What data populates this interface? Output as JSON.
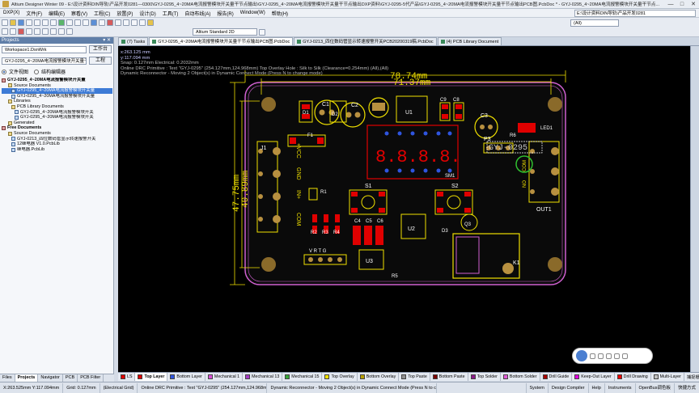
{
  "window": {
    "title": "Altium Designer Winter 09 - E:\\设计资料DIN导轨\\产品开发0281—0300\\GYJ-0295_4~20MA电流报警模块开关量干节点输出\\GYJ-0295_4~20MA电流报警模块开关量干节点输出DXP资料\\GYJ-0295-5代产品\\GYJ-0295_4~20MA电流报警模块开关量干节点输出PCB图.PcbDoc * - GYJ-0295_4~20MA电流报警模块开关量干节点...",
    "min": "—",
    "max": "□",
    "close": "✕"
  },
  "menu": {
    "items": [
      "DXP(X)",
      "文件(F)",
      "编辑(E)",
      "察看(V)",
      "工程(C)",
      "放置(P)",
      "设计(D)",
      "工具(T)",
      "自动布线(A)",
      "报告(R)",
      "Window(W)",
      "帮助(H)"
    ],
    "path": "E:\\设计资料DIN导轨\\产品开发0281"
  },
  "toolbar": {
    "combo_standard": "Altium Standard 2D",
    "combo_all": "(All)"
  },
  "panel": {
    "title": "Projects",
    "workspace": "Workspace1.DsnWrk",
    "workspace_btn": "工作台",
    "project": "GYJ-0295_4~20MA电流报警模块开关量干节点",
    "project_btn": "工程",
    "radio_file": "文件视图",
    "radio_struct": "结构编辑器",
    "tree": [
      {
        "label": "GYJ-0295_4~20MA电流报警模块开关量",
        "indent": 0,
        "icon": "prj",
        "bold": true
      },
      {
        "label": "Source Documents",
        "indent": 2,
        "icon": "folder"
      },
      {
        "label": "GYJ-0295_4~20MA电流报警模块开关量",
        "indent": 3,
        "icon": "doc",
        "sel": true
      },
      {
        "label": "GYJ-0295_4~20MA电流报警模块开关量",
        "indent": 3,
        "icon": "doc"
      },
      {
        "label": "Libraries",
        "indent": 2,
        "icon": "folder"
      },
      {
        "label": "PCB Library Documents",
        "indent": 3,
        "icon": "folder"
      },
      {
        "label": "GYJ-0295_4~20MA电流报警模块开关",
        "indent": 4,
        "icon": "doc"
      },
      {
        "label": "GYJ-0295_4~20MA电流报警模块开关",
        "indent": 4,
        "icon": "doc"
      },
      {
        "label": "Generated",
        "indent": 2,
        "icon": "folder"
      },
      {
        "label": "Free Documents",
        "indent": 0,
        "icon": "prj",
        "bold": true
      },
      {
        "label": "Source Documents",
        "indent": 2,
        "icon": "folder"
      },
      {
        "label": "GYJ-0213_四位数码管显示转速报警开关",
        "indent": 3,
        "icon": "doc"
      },
      {
        "label": "12继电器 V1.0.PcbLib",
        "indent": 3,
        "icon": "doc"
      },
      {
        "label": "继电器.PcbLib",
        "indent": 3,
        "icon": "doc"
      }
    ],
    "tabs": [
      "Files",
      "Projects",
      "Navigator",
      "PCB",
      "PCB Filter"
    ]
  },
  "doc_tabs": [
    {
      "label": "(7) Tasks",
      "active": false
    },
    {
      "label": "GYJ-0295_4~20MA电流报警模块开关量干节点输出PCB图.PcbDoc",
      "active": true
    },
    {
      "label": "GYJ-0213_四位数码管显示转速报警开关PCB20200319稿.PcbDoc",
      "active": false
    },
    {
      "label": "(4) PCB Library Document",
      "active": false
    }
  ],
  "hud": {
    "x": "x:263.125 mm",
    "y": "y:117.094 mm",
    "snap": "Snap: 0.127mm Electrical: 0.2032mm",
    "drc": "Online DRC Primitive : Text \"GYJ-0295\" (254.127mm,124.968mm)  Top Overlay Hole : Silk to Silk (Clearance=0.254mm) (All),(All)",
    "dyn": "Dynamic Reconnector - Moving 2 Object(s) in Dynamic Connect Mode (Press N to change mode)"
  },
  "pcb": {
    "dim_top1": "78.74mm",
    "dim_top2": "71.37mm",
    "dim_left1": "47.75mm",
    "dim_left2": "40.89mm",
    "refs": {
      "c1": "C1",
      "c2": "C2",
      "d1": "D1",
      "d2": "D2",
      "u1": "U1",
      "c9": "C9",
      "c8": "C8",
      "c3": "C3",
      "r5": "R5",
      "led1": "LED1",
      "f1": "F1",
      "j1": "J1",
      "p3": "P3",
      "ovt": "GYJ-0295",
      "out1": "OUT1",
      "r1": "R1",
      "s1": "S1",
      "s2": "S2",
      "r3": "R3",
      "r4": "R4",
      "r2": "R2",
      "c4": "C4",
      "c5": "C5",
      "c6": "C6",
      "u2": "U2",
      "q3": "Q3",
      "d3": "D3",
      "r6": "R6",
      "u3": "U3",
      "k1": "K1",
      "sm1": "SM1",
      "vrtg": "V  R  T  G",
      "con_vcc": "+VCC",
      "con_gnd": "GND",
      "con_in": "IN+",
      "con_com": "COM",
      "out_com": "COM",
      "out_no": "NO"
    }
  },
  "layers": [
    {
      "name": "LS",
      "color": "#e00000",
      "active": false
    },
    {
      "name": "Top Layer",
      "color": "#e00000",
      "active": true
    },
    {
      "name": "Bottom Layer",
      "color": "#2f55e0",
      "active": false
    },
    {
      "name": "Mechanical 1",
      "color": "#d74fd7",
      "active": false
    },
    {
      "name": "Mechanical 13",
      "color": "#a83cc8",
      "active": false
    },
    {
      "name": "Mechanical 15",
      "color": "#38a838",
      "active": false
    },
    {
      "name": "Top Overlay",
      "color": "#f0e000",
      "active": false
    },
    {
      "name": "Bottom Overlay",
      "color": "#b8a000",
      "active": false
    },
    {
      "name": "Top Paste",
      "color": "#909090",
      "active": false
    },
    {
      "name": "Bottom Paste",
      "color": "#7a0000",
      "active": false
    },
    {
      "name": "Top Solder",
      "color": "#8a1a8a",
      "active": false
    },
    {
      "name": "Bottom Solder",
      "color": "#e05ad8",
      "active": false
    },
    {
      "name": "Drill Guide",
      "color": "#a80000",
      "active": false
    },
    {
      "name": "Keep-Out Layer",
      "color": "#e000e0",
      "active": false
    },
    {
      "name": "Drill Drawing",
      "color": "#f00000",
      "active": false
    },
    {
      "name": "Multi-Layer",
      "color": "#c0c0c0",
      "active": false
    }
  ],
  "layers_right": [
    "捕捉栅格",
    "掩膜"
  ],
  "status": {
    "coords": "X:263.525mm Y:117.094mm",
    "grid": "Grid: 0.127mm",
    "mode": "(Electrical Grid)",
    "drc": "Online DRC Primitive : Text \"GYJ-0295\" (254.127mm,124.968mm)  Top O",
    "dyn": "Dynamic Reconnector - Moving 2 Object(s) in Dynamic Connect Mode (Press N to change mode)",
    "right": [
      "System",
      "Design Compiler",
      "Help",
      "Instruments",
      "OpenBus调色板",
      "快捷方式"
    ]
  }
}
